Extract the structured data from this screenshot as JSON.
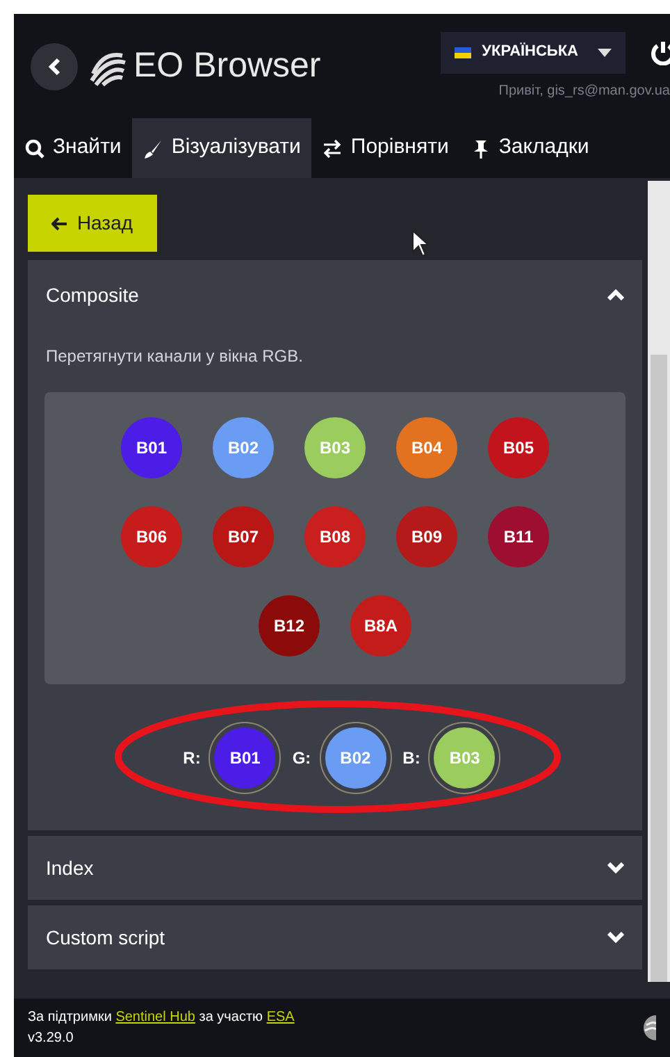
{
  "header": {
    "title": "EO Browser",
    "language": "УКРАЇНСЬКА",
    "greeting": "Привіт, gis_rs@man.gov.ua"
  },
  "tabs": [
    {
      "label": "Знайти",
      "kind": "search",
      "selected": false
    },
    {
      "label": "Візуалізувати",
      "kind": "brush",
      "selected": true
    },
    {
      "label": "Порівняти",
      "kind": "swap",
      "selected": false
    },
    {
      "label": "Закладки",
      "kind": "pin",
      "selected": false
    }
  ],
  "back_button": "Назад",
  "panels": [
    {
      "title": "Composite",
      "expanded": true,
      "hint": "Перетягнути канали у вікна RGB.",
      "bands": [
        {
          "label": "B01",
          "color": "#4b1de6"
        },
        {
          "label": "B02",
          "color": "#6b9cf3"
        },
        {
          "label": "B03",
          "color": "#9bcc5e"
        },
        {
          "label": "B04",
          "color": "#e2721f"
        },
        {
          "label": "B05",
          "color": "#c2141c"
        },
        {
          "label": "B06",
          "color": "#c61c1c"
        },
        {
          "label": "B07",
          "color": "#b91616"
        },
        {
          "label": "B08",
          "color": "#c91f1f"
        },
        {
          "label": "B09",
          "color": "#b41a1a"
        },
        {
          "label": "B11",
          "color": "#9d0e30"
        },
        {
          "label": "B12",
          "color": "#8b0b0b"
        },
        {
          "label": "B8A",
          "color": "#c41b1b"
        }
      ],
      "slots": [
        {
          "channel": "R:",
          "band": "B01",
          "color": "#4b1de6"
        },
        {
          "channel": "G:",
          "band": "B02",
          "color": "#6b9cf3"
        },
        {
          "channel": "B:",
          "band": "B03",
          "color": "#9bcc5e"
        }
      ]
    },
    {
      "title": "Index",
      "expanded": false
    },
    {
      "title": "Custom script",
      "expanded": false
    }
  ],
  "footer": {
    "prefix": "За підтримки",
    "link1": "Sentinel Hub",
    "middle": "за участю",
    "link2": "ESA",
    "version": "v3.29.0"
  }
}
